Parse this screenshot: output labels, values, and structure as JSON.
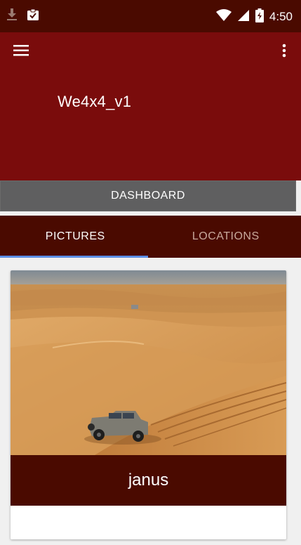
{
  "status_bar": {
    "time": "4:50",
    "icons": [
      "download-icon",
      "clipboard-check-icon",
      "wifi-icon",
      "signal-icon",
      "battery-charging-icon"
    ]
  },
  "app_bar": {
    "title": "We4x4_v1",
    "menu_icon": "hamburger-menu-icon",
    "overflow_icon": "more-vert-icon",
    "color": "#7a0c0c"
  },
  "dashboard_button": {
    "label": "DASHBOARD"
  },
  "tabs": [
    {
      "label": "PICTURES",
      "active": true
    },
    {
      "label": "LOCATIONS",
      "active": false
    }
  ],
  "card": {
    "caption": "janus",
    "image": "desert-dunes-suv-photo"
  },
  "colors": {
    "primary_dark": "#4a0a00",
    "primary": "#7a0c0c",
    "accent": "#5b8ee6",
    "button_gray": "#5f5f60"
  }
}
